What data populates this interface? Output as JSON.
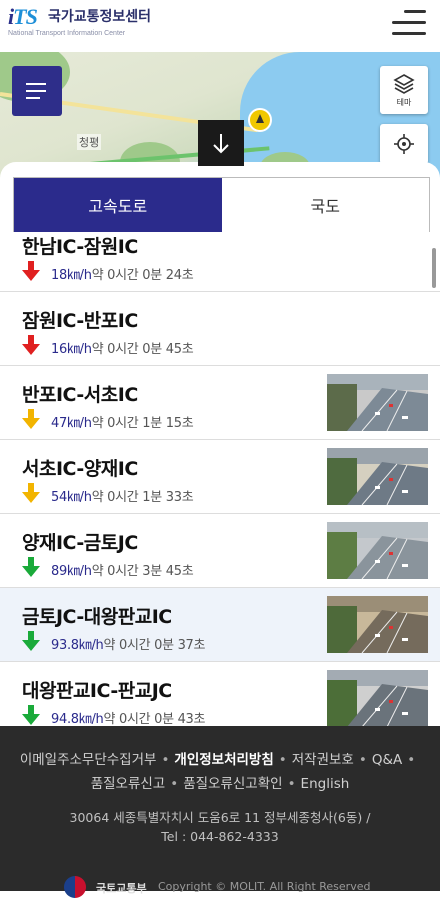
{
  "header": {
    "logo_mark": "iTS",
    "title": "국가교통정보센터",
    "subtitle": "National Transport Information Center"
  },
  "map": {
    "place_label": "청평",
    "theme_label": "테마"
  },
  "tabs": [
    {
      "label": "고속도로",
      "active": true
    },
    {
      "label": "국도",
      "active": false
    }
  ],
  "routes": [
    {
      "name": "한남IC-잠원IC",
      "trend": "down",
      "status_color": "#e02020",
      "speed": "18",
      "unit": "㎞/h",
      "eta": "약 0시간 0분 24초",
      "has_cctv": false
    },
    {
      "name": "잠원IC-반포IC",
      "trend": "down",
      "status_color": "#e02020",
      "speed": "16",
      "unit": "㎞/h",
      "eta": "약 0시간 0분 45초",
      "has_cctv": false
    },
    {
      "name": "반포IC-서초IC",
      "trend": "down",
      "status_color": "#f2b400",
      "speed": "47",
      "unit": "㎞/h",
      "eta": "약 0시간 1분 15초",
      "has_cctv": true
    },
    {
      "name": "서초IC-양재IC",
      "trend": "down",
      "status_color": "#f2b400",
      "speed": "54",
      "unit": "㎞/h",
      "eta": "약 0시간 1분 33초",
      "has_cctv": true
    },
    {
      "name": "양재IC-금토JC",
      "trend": "down",
      "status_color": "#1aaa3a",
      "speed": "89",
      "unit": "㎞/h",
      "eta": "약 0시간 3분 45초",
      "has_cctv": true
    },
    {
      "name": "금토JC-대왕판교IC",
      "trend": "down",
      "status_color": "#1aaa3a",
      "speed": "93.8",
      "unit": "㎞/h",
      "eta": "약 0시간 0분 37초",
      "has_cctv": true,
      "highlighted": true
    },
    {
      "name": "대왕판교IC-판교JC",
      "trend": "down",
      "status_color": "#1aaa3a",
      "speed": "94.8",
      "unit": "㎞/h",
      "eta": "약 0시간 0분 43초",
      "has_cctv": true
    }
  ],
  "footer": {
    "links": [
      "이메일주소무단수집거부",
      "개인정보처리방침",
      "저작권보호",
      "Q&A",
      "품질오류신고",
      "품질오류신고확인",
      "English"
    ],
    "bold_link": "개인정보처리방침",
    "address": "30064 세종특별자치시 도움6로 11 정부세종청사(6동) /",
    "tel": "Tel : 044-862-4333",
    "gov_name": "국토교통부",
    "copyright": "Copyright © MOLIT. All Right Reserved"
  },
  "colors": {
    "primary": "#2b2b8c",
    "red": "#e02020",
    "yellow": "#f2b400",
    "green": "#1aaa3a"
  },
  "icons": [
    "hamburger-icon",
    "layers-icon",
    "locate-icon",
    "arrow-down-icon",
    "cctv-thumbnail"
  ]
}
